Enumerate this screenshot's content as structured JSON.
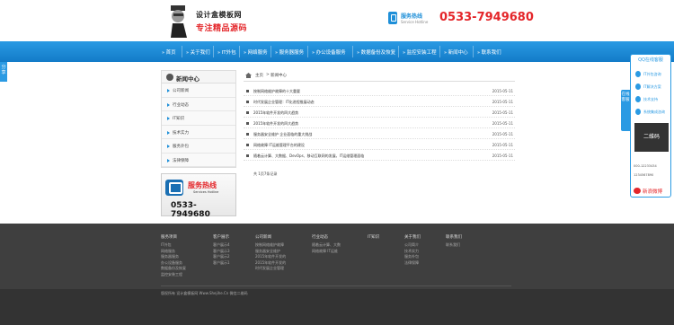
{
  "header": {
    "logo_line1": "设计盒模板网",
    "logo_line2": "专注精品源码",
    "hotline_label": "服务热线",
    "hotline_sub": "Service Hotline",
    "hotline_number": "0533-7949680"
  },
  "nav": {
    "items": [
      "首页",
      "关于我们",
      "IT外包",
      "网络服务",
      "服务器服务",
      "办公设备服务",
      "数据备份及恢复",
      "监控安装工程",
      "新闻中心",
      "联系我们"
    ]
  },
  "side_tab": "分享",
  "sidebar": {
    "title": "新闻中心",
    "items": [
      "公司新闻",
      "行业动态",
      "IT知识",
      "技术实力",
      "服务外包",
      "法律保障"
    ],
    "hot_title": "服务热线",
    "hot_sub": "Services Hotline",
    "hot_number": "0533-7949680"
  },
  "breadcrumb": {
    "home": "主页",
    "sep": ">",
    "current": "新闻中心"
  },
  "news": [
    {
      "title": "按制网络维护故障的十大重要",
      "date": "2015-05-11"
    },
    {
      "title": "时代发展企业管理：IT化进程推展动态",
      "date": "2015-05-11"
    },
    {
      "title": "2015年软件开发的四大趋势",
      "date": "2015-05-11"
    },
    {
      "title": "2015年软件开发的四大趋势",
      "date": "2015-05-11"
    },
    {
      "title": "服务器安全维护 企业面临的重大挑战",
      "date": "2015-05-11"
    },
    {
      "title": "网络故障 IT运维管理平台的建设",
      "date": "2015-05-11"
    },
    {
      "title": "随着云计算、大数据、DevOps、移动互联网的发展，IT运维管理面临",
      "date": "2015-05-11"
    }
  ],
  "pager": "共 1页7条记录",
  "qq_panel": {
    "title": "QQ在线客服",
    "items": [
      "IT外包咨询",
      "IT解决方案",
      "技术支持",
      "系统集成咨询"
    ],
    "qr_label": "二维码",
    "tel1": "000-12233434",
    "tel2": "1234567890",
    "weibo_label": "新浪微博"
  },
  "online_tab": "在线客服",
  "footer": {
    "columns": [
      {
        "title": "服务项目",
        "links": [
          "IT外包",
          "网络服务",
          "服务器服务",
          "办公设备服务",
          "数据备份及恢复",
          "监控安装工程"
        ]
      },
      {
        "title": "客户展示",
        "links": [
          "客户展示4",
          "客户展示3",
          "客户展示2",
          "客户展示1"
        ]
      },
      {
        "title": "公司新闻",
        "links": [
          "按制网络维护故障",
          "服务器安全维护",
          "2015年软件开发的",
          "2015年软件开发的",
          "时代发展企业管理"
        ]
      },
      {
        "title": "行业动态",
        "links": [
          "随着云计算、大数",
          "网络故障 IT运维"
        ]
      },
      {
        "title": "IT知识",
        "links": []
      },
      {
        "title": "关于我们",
        "links": [
          "公司简介",
          "技术实力",
          "服务外包",
          "法律保障"
        ]
      },
      {
        "title": "联系我们",
        "links": [
          "联系我们"
        ]
      }
    ],
    "copyright": "版权所有 设计盒模板网 Www.Shejihe.Cn 微信二维码"
  }
}
